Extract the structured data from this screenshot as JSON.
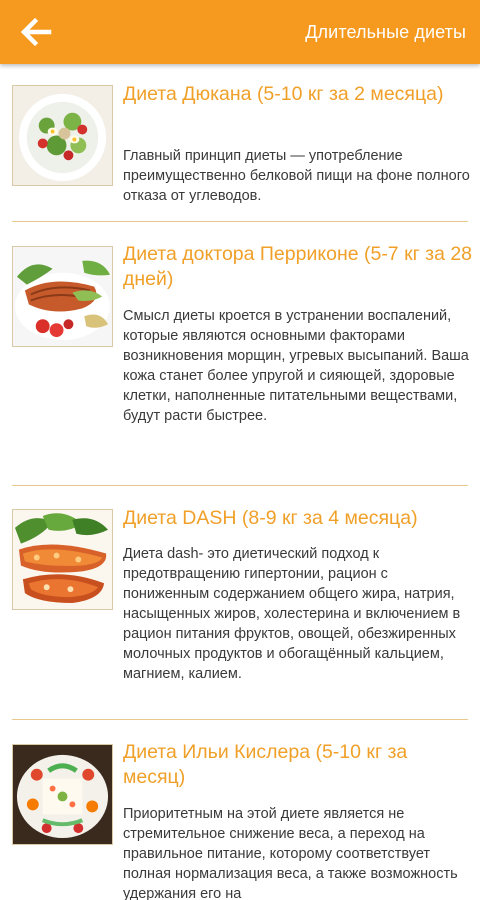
{
  "app_bar": {
    "title": "Длительные диеты",
    "background_color": "#f59a1e",
    "back_icon": "arrow-left-icon"
  },
  "items": [
    {
      "title": "Диета Дюкана (5-10 кг за 2 месяца)",
      "description": "Главный принцип диеты — употребление преимущественно белковой пищи на фоне полного отказа от углеводов.",
      "image": "salad-plate-photo"
    },
    {
      "title": "Диета доктора Перриконе (5-7 кг за 28 дней)",
      "description": "Смысл диеты кроется в устранении воспалений, которые являются основными факторами возникновения морщин, угревых высыпаний. Ваша кожа станет более упругой и сияющей, здоровые клетки, наполненные питательными веществами, будут расти быстрее.",
      "image": "salmon-steak-photo"
    },
    {
      "title": "Диета DASH (8-9 кг за 4 месяца)",
      "description": "Диета dash- это диетический подход к предотвращению гипертонии, рацион с пониженным содержанием общего жира, натрия, насыщенных жиров, холестерина и включением в рацион питания фруктов, овощей, обезжиренных молочных продуктов и обогащённый кальцием, магнием, калием.",
      "image": "stuffed-vegetables-photo"
    },
    {
      "title": "Диета Ильи Кислера (5-10 кг за месяц)",
      "description": "Приоритетным на этой диете является не стремительное снижение веса, а переход на правильное питание, которому соответствует полная нормализация веса, а также возможность удержания его на",
      "image": "vegetable-dish-photo"
    }
  ],
  "colors": {
    "title_text": "#f0a028",
    "body_text": "#3a3a3a",
    "divider": "#e9c990"
  }
}
